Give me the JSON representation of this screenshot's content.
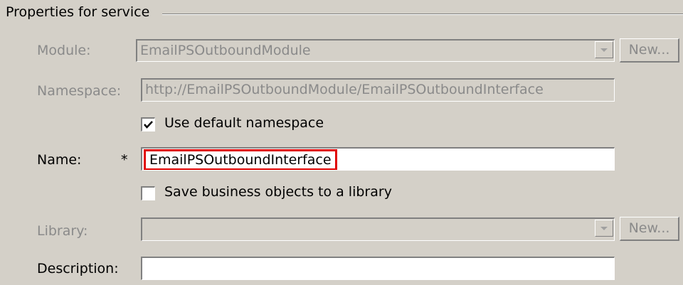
{
  "group": {
    "title": "Properties for service"
  },
  "module": {
    "label": "Module:",
    "value": "EmailPSOutboundModule",
    "new_label": "New..."
  },
  "namespace": {
    "label": "Namespace:",
    "value": "http://EmailPSOutboundModule/EmailPSOutboundInterface"
  },
  "use_default_namespace": {
    "label": "Use default namespace",
    "checked": true
  },
  "name": {
    "label": "Name:",
    "required_marker": "*",
    "value": "EmailPSOutboundInterface"
  },
  "save_business_objects": {
    "label": "Save business objects to a library",
    "checked": false
  },
  "library": {
    "label": "Library:",
    "value": "",
    "new_label": "New..."
  },
  "description": {
    "label": "Description:",
    "value": ""
  },
  "colors": {
    "highlight_border": "#e00000",
    "background": "#d4d0c8",
    "disabled_text": "#8a8a8a"
  }
}
